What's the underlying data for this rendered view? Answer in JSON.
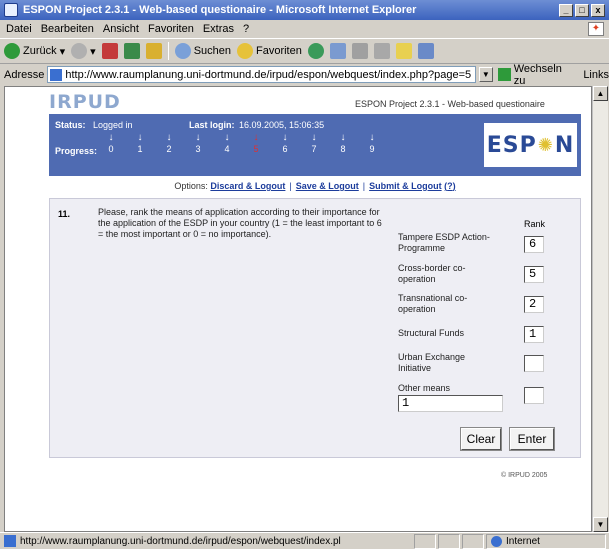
{
  "window": {
    "title": "ESPON Project 2.3.1 - Web-based questionaire - Microsoft Internet Explorer",
    "controls": {
      "minimize": "_",
      "maximize": "□",
      "close": "x"
    }
  },
  "menubar": {
    "items": [
      "Datei",
      "Bearbeiten",
      "Ansicht",
      "Favoriten",
      "Extras",
      "?"
    ]
  },
  "toolbar": {
    "back": "Zurück",
    "search": "Suchen",
    "favorites": "Favoriten"
  },
  "address": {
    "label": "Adresse",
    "url": "http://www.raumplanung.uni-dortmund.de/irpud/espon/webquest/index.php?page=5",
    "go": "Wechseln zu",
    "links": "Links"
  },
  "page": {
    "logo_text": "IRPUD",
    "project_title": "ESPON Project 2.3.1 - Web-based questionaire",
    "status_label": "Status:",
    "status_value": "Logged in",
    "last_login_label": "Last login:",
    "last_login_value": "16.09.2005, 15:06:35",
    "progress_label": "Progress:",
    "progress_steps": [
      "0",
      "1",
      "2",
      "3",
      "4",
      "5",
      "6",
      "7",
      "8",
      "9"
    ],
    "current_step": 5,
    "espon_logo": {
      "left": "ESP",
      "right": "N"
    },
    "options_label": "Options:",
    "options": {
      "discard": "Discard & Logout",
      "save": "Save & Logout",
      "submit": "Submit & Logout",
      "help": "?"
    },
    "question": {
      "number": "11.",
      "text": "Please, rank the means of application according to their importance for the application of the ESDP in your country (1 = the least important to 6 = the most important or 0 = no importance).",
      "rank_header": "Rank",
      "items": [
        {
          "label": "Tampere ESDP Action-Programme",
          "rank": "6"
        },
        {
          "label": "Cross-border co-operation",
          "rank": "5"
        },
        {
          "label": "Transnational co-operation",
          "rank": "2"
        },
        {
          "label": "Structural Funds",
          "rank": "1"
        },
        {
          "label": "Urban Exchange Initiative",
          "rank": ""
        },
        {
          "label": "Other means",
          "rank": ""
        }
      ],
      "other_means_value": "1"
    },
    "buttons": {
      "clear": "Clear",
      "enter": "Enter"
    },
    "copyright": "© IRPUD 2005"
  },
  "statusbar": {
    "url": "http://www.raumplanung.uni-dortmund.de/irpud/espon/webquest/index.pl",
    "zone": "Internet"
  }
}
